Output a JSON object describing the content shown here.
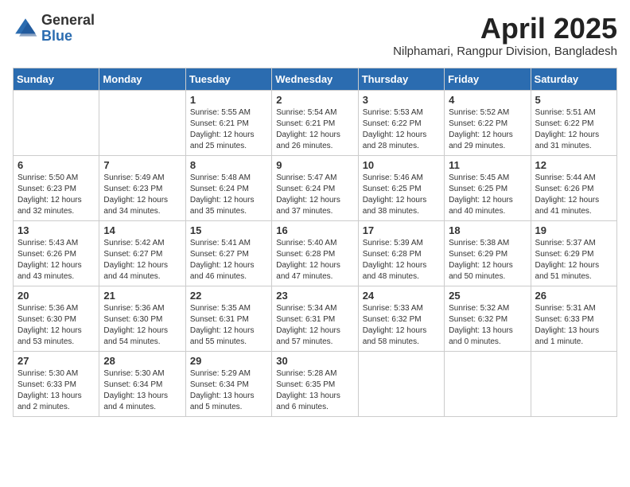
{
  "header": {
    "logo_general": "General",
    "logo_blue": "Blue",
    "title": "April 2025",
    "subtitle": "Nilphamari, Rangpur Division, Bangladesh"
  },
  "days_of_week": [
    "Sunday",
    "Monday",
    "Tuesday",
    "Wednesday",
    "Thursday",
    "Friday",
    "Saturday"
  ],
  "weeks": [
    [
      {
        "day": "",
        "sunrise": "",
        "sunset": "",
        "daylight": ""
      },
      {
        "day": "",
        "sunrise": "",
        "sunset": "",
        "daylight": ""
      },
      {
        "day": "1",
        "sunrise": "Sunrise: 5:55 AM",
        "sunset": "Sunset: 6:21 PM",
        "daylight": "Daylight: 12 hours and 25 minutes."
      },
      {
        "day": "2",
        "sunrise": "Sunrise: 5:54 AM",
        "sunset": "Sunset: 6:21 PM",
        "daylight": "Daylight: 12 hours and 26 minutes."
      },
      {
        "day": "3",
        "sunrise": "Sunrise: 5:53 AM",
        "sunset": "Sunset: 6:22 PM",
        "daylight": "Daylight: 12 hours and 28 minutes."
      },
      {
        "day": "4",
        "sunrise": "Sunrise: 5:52 AM",
        "sunset": "Sunset: 6:22 PM",
        "daylight": "Daylight: 12 hours and 29 minutes."
      },
      {
        "day": "5",
        "sunrise": "Sunrise: 5:51 AM",
        "sunset": "Sunset: 6:22 PM",
        "daylight": "Daylight: 12 hours and 31 minutes."
      }
    ],
    [
      {
        "day": "6",
        "sunrise": "Sunrise: 5:50 AM",
        "sunset": "Sunset: 6:23 PM",
        "daylight": "Daylight: 12 hours and 32 minutes."
      },
      {
        "day": "7",
        "sunrise": "Sunrise: 5:49 AM",
        "sunset": "Sunset: 6:23 PM",
        "daylight": "Daylight: 12 hours and 34 minutes."
      },
      {
        "day": "8",
        "sunrise": "Sunrise: 5:48 AM",
        "sunset": "Sunset: 6:24 PM",
        "daylight": "Daylight: 12 hours and 35 minutes."
      },
      {
        "day": "9",
        "sunrise": "Sunrise: 5:47 AM",
        "sunset": "Sunset: 6:24 PM",
        "daylight": "Daylight: 12 hours and 37 minutes."
      },
      {
        "day": "10",
        "sunrise": "Sunrise: 5:46 AM",
        "sunset": "Sunset: 6:25 PM",
        "daylight": "Daylight: 12 hours and 38 minutes."
      },
      {
        "day": "11",
        "sunrise": "Sunrise: 5:45 AM",
        "sunset": "Sunset: 6:25 PM",
        "daylight": "Daylight: 12 hours and 40 minutes."
      },
      {
        "day": "12",
        "sunrise": "Sunrise: 5:44 AM",
        "sunset": "Sunset: 6:26 PM",
        "daylight": "Daylight: 12 hours and 41 minutes."
      }
    ],
    [
      {
        "day": "13",
        "sunrise": "Sunrise: 5:43 AM",
        "sunset": "Sunset: 6:26 PM",
        "daylight": "Daylight: 12 hours and 43 minutes."
      },
      {
        "day": "14",
        "sunrise": "Sunrise: 5:42 AM",
        "sunset": "Sunset: 6:27 PM",
        "daylight": "Daylight: 12 hours and 44 minutes."
      },
      {
        "day": "15",
        "sunrise": "Sunrise: 5:41 AM",
        "sunset": "Sunset: 6:27 PM",
        "daylight": "Daylight: 12 hours and 46 minutes."
      },
      {
        "day": "16",
        "sunrise": "Sunrise: 5:40 AM",
        "sunset": "Sunset: 6:28 PM",
        "daylight": "Daylight: 12 hours and 47 minutes."
      },
      {
        "day": "17",
        "sunrise": "Sunrise: 5:39 AM",
        "sunset": "Sunset: 6:28 PM",
        "daylight": "Daylight: 12 hours and 48 minutes."
      },
      {
        "day": "18",
        "sunrise": "Sunrise: 5:38 AM",
        "sunset": "Sunset: 6:29 PM",
        "daylight": "Daylight: 12 hours and 50 minutes."
      },
      {
        "day": "19",
        "sunrise": "Sunrise: 5:37 AM",
        "sunset": "Sunset: 6:29 PM",
        "daylight": "Daylight: 12 hours and 51 minutes."
      }
    ],
    [
      {
        "day": "20",
        "sunrise": "Sunrise: 5:36 AM",
        "sunset": "Sunset: 6:30 PM",
        "daylight": "Daylight: 12 hours and 53 minutes."
      },
      {
        "day": "21",
        "sunrise": "Sunrise: 5:36 AM",
        "sunset": "Sunset: 6:30 PM",
        "daylight": "Daylight: 12 hours and 54 minutes."
      },
      {
        "day": "22",
        "sunrise": "Sunrise: 5:35 AM",
        "sunset": "Sunset: 6:31 PM",
        "daylight": "Daylight: 12 hours and 55 minutes."
      },
      {
        "day": "23",
        "sunrise": "Sunrise: 5:34 AM",
        "sunset": "Sunset: 6:31 PM",
        "daylight": "Daylight: 12 hours and 57 minutes."
      },
      {
        "day": "24",
        "sunrise": "Sunrise: 5:33 AM",
        "sunset": "Sunset: 6:32 PM",
        "daylight": "Daylight: 12 hours and 58 minutes."
      },
      {
        "day": "25",
        "sunrise": "Sunrise: 5:32 AM",
        "sunset": "Sunset: 6:32 PM",
        "daylight": "Daylight: 13 hours and 0 minutes."
      },
      {
        "day": "26",
        "sunrise": "Sunrise: 5:31 AM",
        "sunset": "Sunset: 6:33 PM",
        "daylight": "Daylight: 13 hours and 1 minute."
      }
    ],
    [
      {
        "day": "27",
        "sunrise": "Sunrise: 5:30 AM",
        "sunset": "Sunset: 6:33 PM",
        "daylight": "Daylight: 13 hours and 2 minutes."
      },
      {
        "day": "28",
        "sunrise": "Sunrise: 5:30 AM",
        "sunset": "Sunset: 6:34 PM",
        "daylight": "Daylight: 13 hours and 4 minutes."
      },
      {
        "day": "29",
        "sunrise": "Sunrise: 5:29 AM",
        "sunset": "Sunset: 6:34 PM",
        "daylight": "Daylight: 13 hours and 5 minutes."
      },
      {
        "day": "30",
        "sunrise": "Sunrise: 5:28 AM",
        "sunset": "Sunset: 6:35 PM",
        "daylight": "Daylight: 13 hours and 6 minutes."
      },
      {
        "day": "",
        "sunrise": "",
        "sunset": "",
        "daylight": ""
      },
      {
        "day": "",
        "sunrise": "",
        "sunset": "",
        "daylight": ""
      },
      {
        "day": "",
        "sunrise": "",
        "sunset": "",
        "daylight": ""
      }
    ]
  ]
}
